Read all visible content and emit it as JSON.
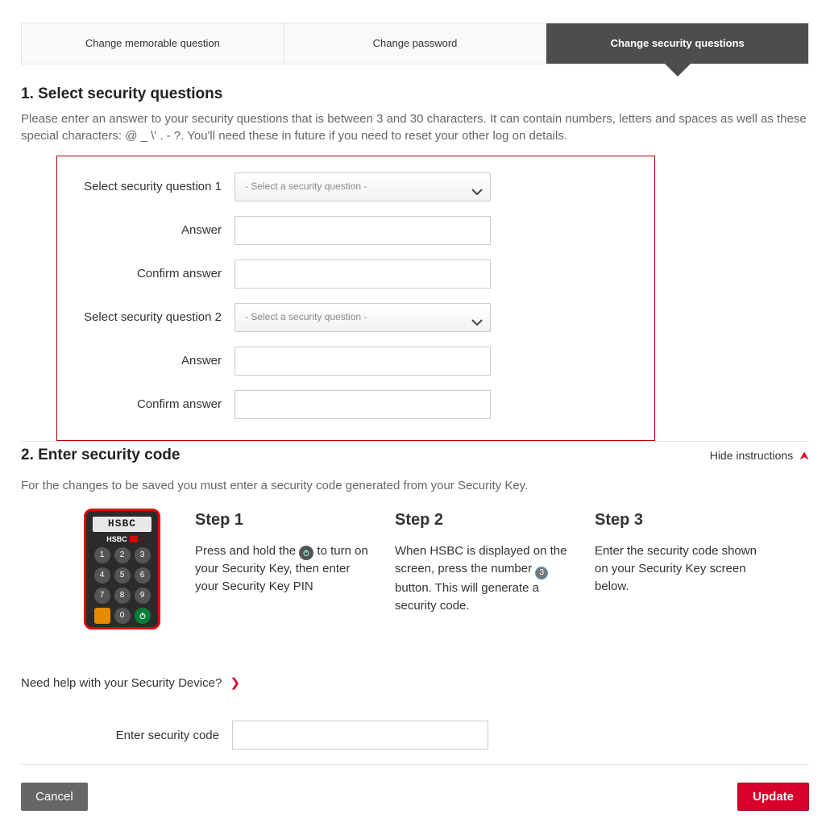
{
  "tabs": {
    "memorable": "Change memorable question",
    "password": "Change password",
    "security": "Change security questions"
  },
  "section1": {
    "title": "1. Select security questions",
    "intro": "Please enter an answer to your security questions that is between 3 and 30 characters. It can contain numbers, letters and spaces as well as these special characters: @ _ \\' . - ?. You'll need these in future if you need to reset your other log on details.",
    "q1_label": "Select security question 1",
    "q2_label": "Select security question 2",
    "select_placeholder": "- Select a security question -",
    "answer_label": "Answer",
    "confirm_label": "Confirm answer"
  },
  "section2": {
    "title": "2. Enter security code",
    "hide": "Hide instructions",
    "intro": "For the changes to be saved you must enter a security code generated from your Security Key.",
    "device_screen": "HSBC",
    "device_brand": "HSBC",
    "step1_title": "Step 1",
    "step1_pre": "Press and hold the ",
    "step1_post": " to turn on your Security Key, then enter your Security Key PIN",
    "step2_title": "Step 2",
    "step2_pre": "When HSBC is displayed on the screen, press the number ",
    "step2_num": "3",
    "step2_post": " button. This will generate a security code.",
    "step3_title": "Step 3",
    "step3_body": "Enter the security code shown on your Security Key screen below.",
    "help": "Need help with your Security Device?",
    "code_label": "Enter security code"
  },
  "buttons": {
    "cancel": "Cancel",
    "update": "Update"
  }
}
